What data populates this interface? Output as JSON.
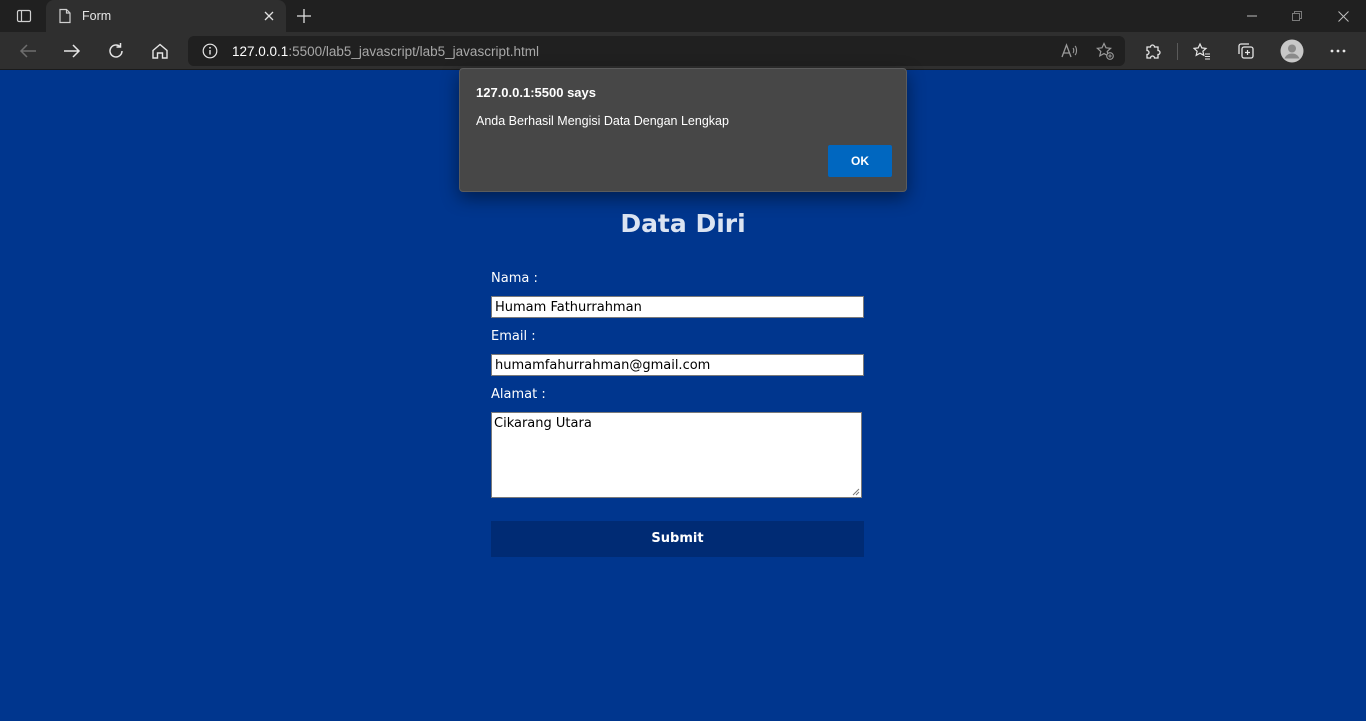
{
  "browser": {
    "tab_title": "Form",
    "url_host": "127.0.0.1",
    "url_path": ":5500/lab5_javascript/lab5_javascript.html"
  },
  "dialog": {
    "title": "127.0.0.1:5500 says",
    "message": "Anda Berhasil Mengisi Data Dengan Lengkap",
    "ok_label": "OK"
  },
  "form": {
    "title": "Data Diri",
    "nama_label": "Nama :",
    "nama_value": "Humam Fathurrahman",
    "email_label": "Email :",
    "email_value": "humamfahurrahman@gmail.com",
    "alamat_label": "Alamat :",
    "alamat_value": "Cikarang Utara",
    "submit_label": "Submit"
  },
  "colors": {
    "page_background": "#00368e",
    "submit_background": "#002b74",
    "dialog_ok": "#0067c0"
  },
  "icons": [
    "tab-actions-icon",
    "page-icon",
    "close-tab-icon",
    "new-tab-icon",
    "minimize-icon",
    "restore-icon",
    "close-window-icon",
    "back-icon",
    "forward-icon",
    "refresh-icon",
    "home-icon",
    "info-icon",
    "read-aloud-icon",
    "add-favorite-icon",
    "extensions-icon",
    "favorites-icon",
    "collections-icon",
    "profile-icon",
    "more-icon"
  ]
}
